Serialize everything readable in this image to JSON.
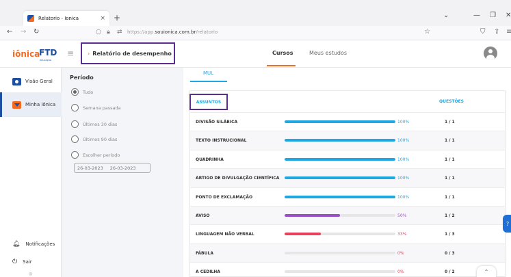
{
  "browser": {
    "tab_title": "Relatorio - Ionica",
    "tab_close": "×",
    "new_tab": "+",
    "url_prefix": "https://app.",
    "url_domain": "souionica.com.br",
    "url_path": "/relatorio"
  },
  "header": {
    "logo_text": "iônica",
    "logo_brand": "FTD",
    "logo_brand_sub": "educação",
    "title": "Relatório de desempenho",
    "tabs": [
      {
        "label": "Cursos",
        "active": true
      },
      {
        "label": "Meus estudos",
        "active": false
      }
    ]
  },
  "sidebar": {
    "items": [
      {
        "label": "Visão Geral",
        "icon": "eye-icon"
      },
      {
        "label": "Minha iônica",
        "icon": "ionica-icon",
        "active": true
      }
    ],
    "bottom": [
      {
        "label": "Notificações",
        "icon": "bell-icon"
      },
      {
        "label": "Sair",
        "icon": "power-icon"
      }
    ]
  },
  "filter": {
    "title": "Período",
    "options": [
      {
        "label": "Tudo",
        "checked": true
      },
      {
        "label": "Semana passada",
        "checked": false
      },
      {
        "label": "Últimos 30 dias",
        "checked": false
      },
      {
        "label": "Últimos 90 dias",
        "checked": false
      },
      {
        "label": "Escolher período",
        "checked": false
      }
    ],
    "date_from": "26-03-2023",
    "date_to": "26-03-2023"
  },
  "main": {
    "subject_tab": "MUL",
    "col_assuntos": "ASSUNTOS",
    "col_questoes": "QUESTÕES",
    "rows": [
      {
        "name": "DIVISÃO SILÁBICA",
        "pct": 100,
        "pct_label": "100%",
        "color": "#1ea7e1",
        "q": "1 / 1"
      },
      {
        "name": "TEXTO INSTRUCIONAL",
        "pct": 100,
        "pct_label": "100%",
        "color": "#1ea7e1",
        "q": "1 / 1"
      },
      {
        "name": "QUADRINHA",
        "pct": 100,
        "pct_label": "100%",
        "color": "#1ea7e1",
        "q": "1 / 1"
      },
      {
        "name": "ARTIGO DE DIVULGAÇÃO CIENTÍFICA",
        "pct": 100,
        "pct_label": "100%",
        "color": "#1ea7e1",
        "q": "1 / 1"
      },
      {
        "name": "PONTO DE EXCLAMAÇÃO",
        "pct": 100,
        "pct_label": "100%",
        "color": "#1ea7e1",
        "q": "1 / 1"
      },
      {
        "name": "AVISO",
        "pct": 50,
        "pct_label": "50%",
        "color": "#9b4fc4",
        "q": "1 / 2"
      },
      {
        "name": "LINGUAGEM NÃO VERBAL",
        "pct": 33,
        "pct_label": "33%",
        "color": "#e8415b",
        "q": "1 / 3"
      },
      {
        "name": "FÁBULA",
        "pct": 0,
        "pct_label": "0%",
        "color": "#e8415b",
        "q": "0 / 3"
      },
      {
        "name": "A CEDILHA",
        "pct": 0,
        "pct_label": "0%",
        "color": "#e8415b",
        "q": "0 / 2"
      }
    ]
  },
  "colors": {
    "accent_blue": "#1ea7e1",
    "brand_blue": "#1d4fa2",
    "brand_orange": "#f36b21",
    "highlight_purple": "#5b2d91"
  }
}
